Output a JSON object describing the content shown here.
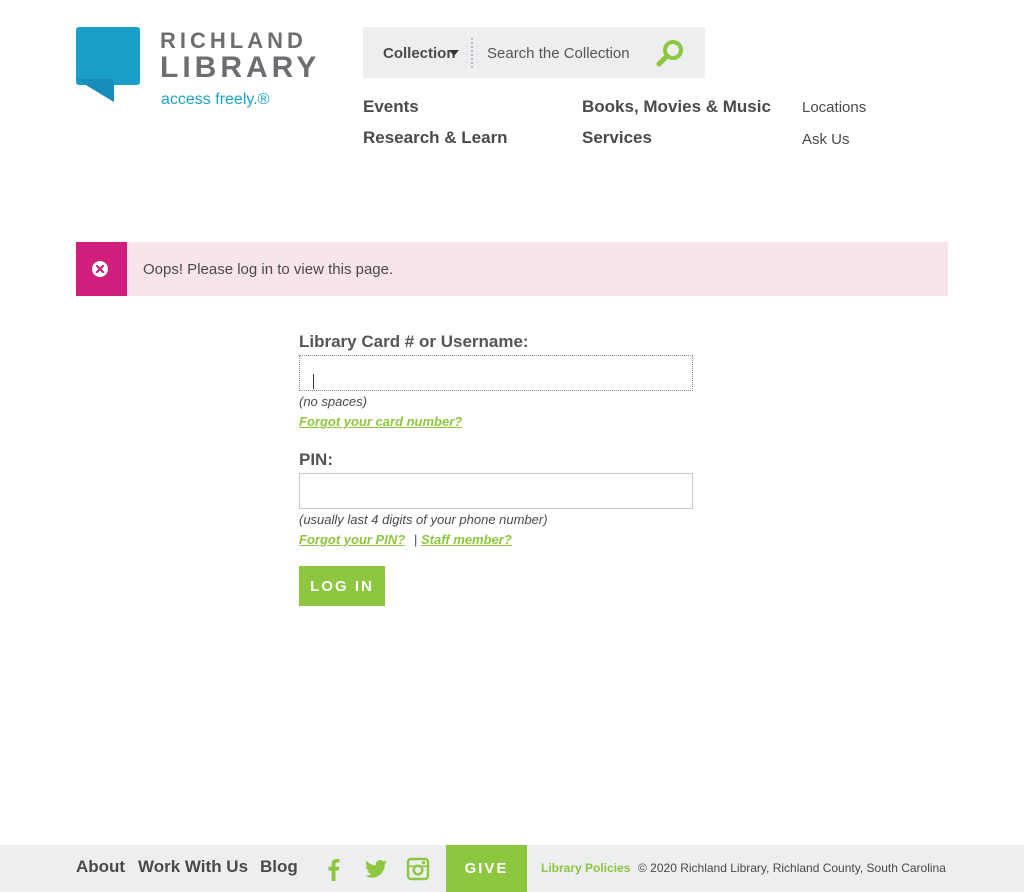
{
  "brand": {
    "top": "RICHLAND",
    "bottom": "LIBRARY",
    "tagline": "access freely.®",
    "colors": {
      "teal": "#1aa0c8",
      "gray": "#6d6e71",
      "green": "#8dc63f",
      "magenta": "#d01e7c"
    }
  },
  "search": {
    "select_value": "Collection",
    "placeholder": "Search the Collection",
    "button_icon": "search-icon"
  },
  "nav": {
    "events": "Events",
    "research": "Research & Learn",
    "books": "Books, Movies & Music",
    "services": "Services",
    "locations": "Locations",
    "ask": "Ask Us"
  },
  "alert": {
    "icon": "close-circle-icon",
    "message": "Oops! Please log in to view this page."
  },
  "form": {
    "card_label": "Library Card # or Username:",
    "card_value": "",
    "card_hint": "(no spaces)",
    "forgot_card": "Forgot your card number?",
    "pin_label": "PIN:",
    "pin_value": "",
    "pin_hint": "(usually last 4 digits of your phone number)",
    "forgot_pin": "Forgot your PIN?",
    "separator": "|",
    "staff": "Staff member?",
    "submit": "LOG IN"
  },
  "footer": {
    "about": "About",
    "work": "Work With Us",
    "blog": "Blog",
    "social": [
      "facebook-icon",
      "twitter-icon",
      "instagram-icon"
    ],
    "give": "GIVE",
    "policies": "Library Policies",
    "copyright": "© 2020 Richland Library, Richland County, South Carolina"
  }
}
